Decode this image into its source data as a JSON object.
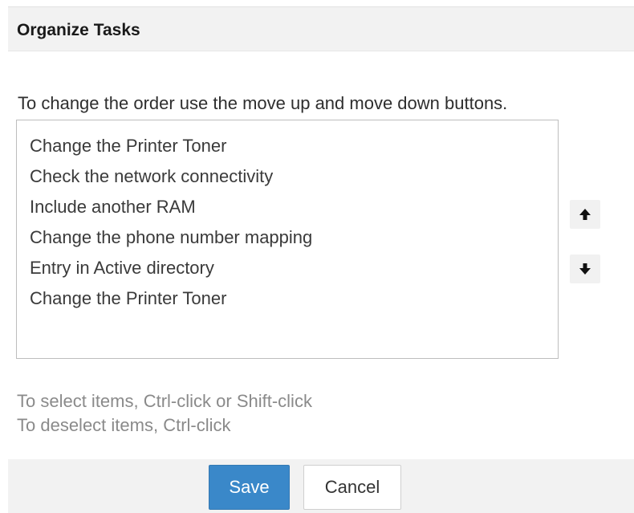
{
  "dialog": {
    "title": "Organize Tasks",
    "instruction": "To change the order use the move up and move down buttons."
  },
  "tasks": [
    {
      "label": "Change the Printer Toner"
    },
    {
      "label": "Check the network connectivity"
    },
    {
      "label": "Include another RAM"
    },
    {
      "label": "Change the phone number mapping"
    },
    {
      "label": "Entry in Active directory"
    },
    {
      "label": "Change the Printer Toner"
    }
  ],
  "controls": {
    "move_up_icon": "arrow-up-icon",
    "move_down_icon": "arrow-down-icon"
  },
  "hints": {
    "select": "To select items, Ctrl-click or Shift-click",
    "deselect": "To deselect items, Ctrl-click"
  },
  "footer": {
    "save_label": "Save",
    "cancel_label": "Cancel"
  },
  "colors": {
    "primary_button": "#3a88c9",
    "header_background": "#f2f2f2",
    "hint_text": "#8a8a8a"
  }
}
